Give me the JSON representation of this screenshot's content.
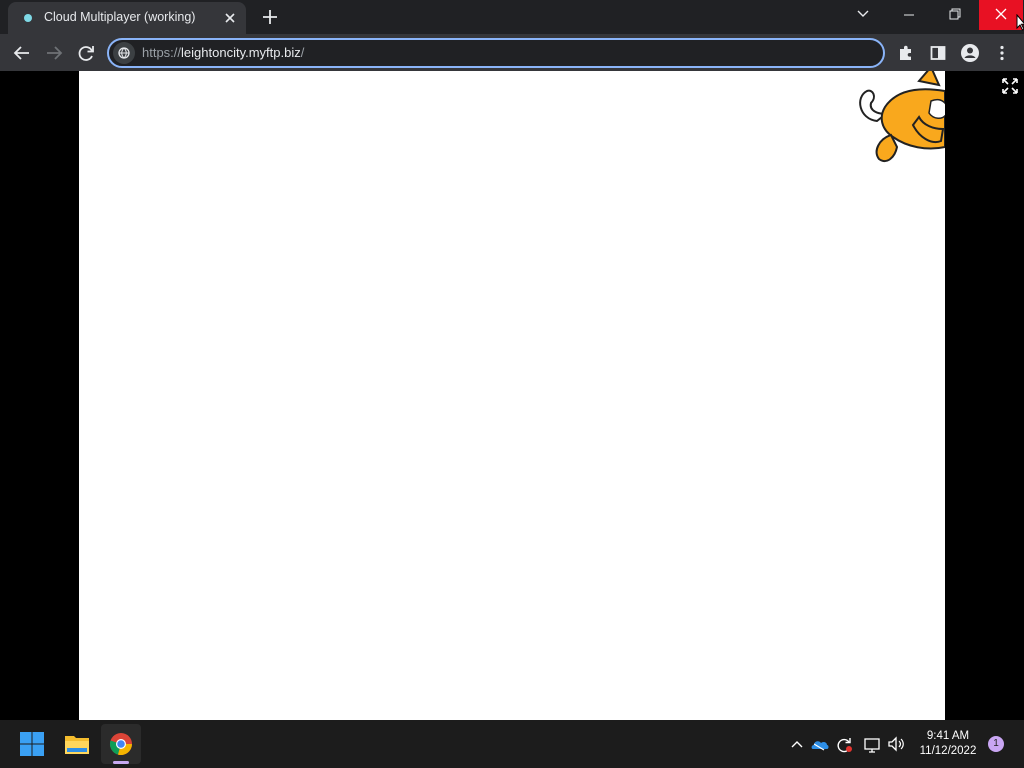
{
  "browser": {
    "tab": {
      "title": "Cloud Multiplayer (working)"
    },
    "address": {
      "scheme": "https://",
      "host": "leightoncity.myftp.biz",
      "path": "/"
    }
  },
  "taskbar": {
    "clock": {
      "time": "9:41 AM",
      "date": "11/12/2022"
    },
    "notification_count": "1"
  },
  "colors": {
    "accent": "#8ab4f8",
    "close_button": "#e81123",
    "sprite_orange": "#f9a81d"
  }
}
